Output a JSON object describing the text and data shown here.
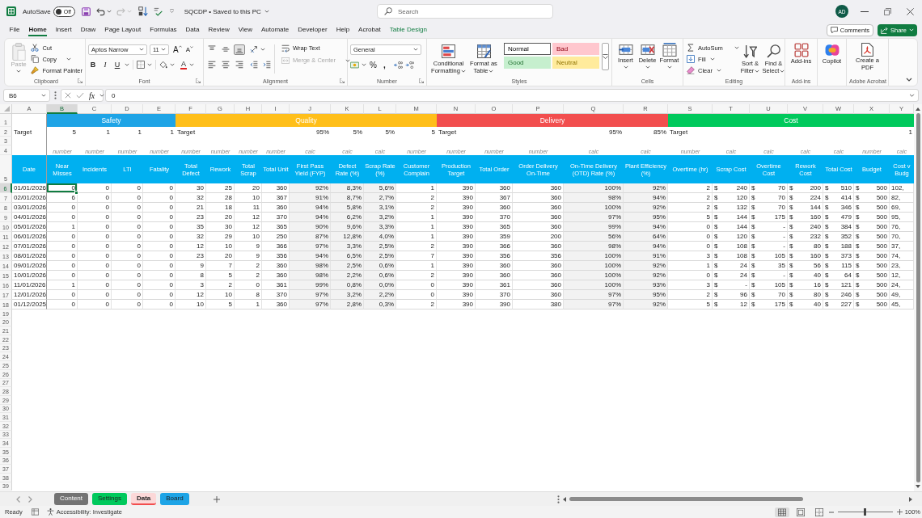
{
  "title_bar": {
    "autosave": {
      "label": "AutoSave",
      "toggle_label": "Off",
      "on": false
    },
    "undo": {
      "disabled": false
    },
    "redo": {
      "disabled": true
    },
    "document_title": "SQCDP • Saved to this PC",
    "search": {
      "placeholder": "Search"
    },
    "account_initials": "AD"
  },
  "ribbon_tabs": [
    {
      "label": "File",
      "selected": false,
      "kind": "standard"
    },
    {
      "label": "Home",
      "selected": true,
      "kind": "standard"
    },
    {
      "label": "Insert",
      "selected": false,
      "kind": "standard"
    },
    {
      "label": "Draw",
      "selected": false,
      "kind": "standard"
    },
    {
      "label": "Page Layout",
      "selected": false,
      "kind": "standard"
    },
    {
      "label": "Formulas",
      "selected": false,
      "kind": "standard"
    },
    {
      "label": "Data",
      "selected": false,
      "kind": "standard"
    },
    {
      "label": "Review",
      "selected": false,
      "kind": "standard"
    },
    {
      "label": "View",
      "selected": false,
      "kind": "standard"
    },
    {
      "label": "Automate",
      "selected": false,
      "kind": "standard"
    },
    {
      "label": "Developer",
      "selected": false,
      "kind": "standard"
    },
    {
      "label": "Help",
      "selected": false,
      "kind": "standard"
    },
    {
      "label": "Acrobat",
      "selected": false,
      "kind": "standard"
    },
    {
      "label": "Table Design",
      "selected": false,
      "kind": "contextual"
    }
  ],
  "comments_button": "Comments",
  "share_button": "Share",
  "ribbon": {
    "clipboard": {
      "label": "Clipboard",
      "paste": {
        "label": "Paste",
        "disabled": true
      },
      "actions": [
        {
          "label": "Cut",
          "disabled": false
        },
        {
          "label": "Copy",
          "disabled": false
        },
        {
          "label": "Format Painter",
          "disabled": false
        }
      ]
    },
    "font": {
      "label": "Font",
      "font_name": "Aptos Narrow",
      "font_size": "11",
      "grow_button": "A",
      "shrink_button": "A",
      "style_buttons": [
        "B",
        "I",
        "U"
      ],
      "color_button": "A"
    },
    "alignment": {
      "label": "Alignment",
      "vertical_buttons": [
        {
          "selected": false
        },
        {
          "selected": false
        },
        {
          "selected": true
        }
      ],
      "horizontal_buttons": [
        {
          "selected": false
        },
        {
          "selected": false
        },
        {
          "selected": false
        }
      ],
      "wrap_text": {
        "label": "Wrap Text",
        "disabled": false
      },
      "merge": {
        "label": "Merge & Center",
        "disabled": true
      }
    },
    "number": {
      "label": "Number",
      "format": "General",
      "percent_button": "%",
      "comma_button": ","
    },
    "styles": {
      "label": "Styles",
      "commands": [
        "Conditional Formatting",
        "Format as Table"
      ],
      "gallery": [
        {
          "label": "Normal",
          "color": "#ffffff",
          "selected": true
        },
        {
          "label": "Bad",
          "color": "#ffc7ce",
          "selected": false
        },
        {
          "label": "Good",
          "color": "#c6efce",
          "selected": false
        },
        {
          "label": "Neutral",
          "color": "#ffeb9c",
          "selected": false
        }
      ]
    },
    "cells": {
      "label": "Cells",
      "commands": [
        "Insert",
        "Delete",
        "Format"
      ]
    },
    "editing": {
      "label": "Editing",
      "small_commands": [
        "AutoSum",
        "Fill",
        "Clear"
      ],
      "large_commands": [
        "Sort & Filter",
        "Find & Select"
      ]
    },
    "add_ins": {
      "label": "Add-ins",
      "command": "Add-ins"
    },
    "copilot": {
      "command": "Copilot"
    },
    "adobe_acrobat": {
      "label": "Adobe Acrobat",
      "command": "Create a PDF"
    }
  },
  "formula_bar": {
    "name_box": "B6",
    "function_label": "fx",
    "formula": "0"
  },
  "sheet": {
    "lead_column": {
      "letter": "A",
      "selected": false,
      "kind": "text",
      "shaded": false,
      "target_label": "Target",
      "header": "Date",
      "cells": [
        "01/01/2026",
        "02/01/2026",
        "03/01/2026",
        "04/01/2026",
        "05/01/2026",
        "06/01/2026",
        "07/01/2026",
        "08/01/2026",
        "09/01/2026",
        "10/01/2026",
        "11/01/2026",
        "12/01/2026",
        "01/12/2025"
      ]
    },
    "sections": [
      {
        "label": "Safety",
        "color": "#1ea4e6",
        "columns": [
          {
            "letter": "B",
            "selected": true,
            "kind": "number",
            "shaded": false,
            "target": "5",
            "entry_type": "number",
            "header": "Near Misses",
            "cells": [
              "0",
              "6",
              "0",
              "0",
              "1",
              "0",
              "0",
              "0",
              "0",
              "0",
              "1",
              "0",
              "0"
            ]
          },
          {
            "letter": "C",
            "selected": false,
            "kind": "number",
            "shaded": false,
            "target": "1",
            "entry_type": "number",
            "header": "Incidents",
            "cells": [
              "0",
              "0",
              "0",
              "0",
              "0",
              "0",
              "0",
              "0",
              "0",
              "0",
              "0",
              "0",
              "0"
            ]
          },
          {
            "letter": "D",
            "selected": false,
            "kind": "number",
            "shaded": false,
            "target": "1",
            "entry_type": "number",
            "header": "LTI",
            "cells": [
              "0",
              "0",
              "0",
              "0",
              "0",
              "0",
              "0",
              "0",
              "0",
              "0",
              "0",
              "0",
              "0"
            ]
          },
          {
            "letter": "E",
            "selected": false,
            "kind": "number",
            "shaded": false,
            "target": "1",
            "entry_type": "number",
            "header": "Fatality",
            "cells": [
              "0",
              "0",
              "0",
              "0",
              "0",
              "0",
              "0",
              "0",
              "0",
              "0",
              "0",
              "0",
              "0"
            ]
          }
        ]
      },
      {
        "label": "Quality",
        "color": "#ffbf1a",
        "columns": [
          {
            "letter": "F",
            "selected": false,
            "kind": "number",
            "shaded": false,
            "target_label": "Target",
            "entry_type": "number",
            "header": "Total Defect",
            "cells": [
              "30",
              "32",
              "21",
              "23",
              "35",
              "32",
              "12",
              "23",
              "9",
              "8",
              "3",
              "12",
              "10"
            ]
          },
          {
            "letter": "G",
            "selected": false,
            "kind": "number",
            "shaded": false,
            "entry_type": "number",
            "header": "Rework",
            "cells": [
              "25",
              "28",
              "18",
              "20",
              "30",
              "29",
              "10",
              "20",
              "7",
              "5",
              "2",
              "10",
              "5"
            ]
          },
          {
            "letter": "H",
            "selected": false,
            "kind": "number",
            "shaded": false,
            "entry_type": "number",
            "header": "Total Scrap",
            "cells": [
              "20",
              "10",
              "11",
              "12",
              "12",
              "10",
              "9",
              "9",
              "2",
              "2",
              "0",
              "8",
              "1"
            ]
          },
          {
            "letter": "I",
            "selected": false,
            "kind": "number",
            "shaded": false,
            "entry_type": "number",
            "header": "Total Unit",
            "cells": [
              "360",
              "367",
              "360",
              "370",
              "365",
              "250",
              "366",
              "356",
              "360",
              "360",
              "361",
              "370",
              "360"
            ]
          },
          {
            "letter": "J",
            "selected": false,
            "kind": "number",
            "shaded": true,
            "target": "95%",
            "entry_type": "calc",
            "header": "First Pass Yield (FYP)",
            "cells": [
              "92%",
              "91%",
              "94%",
              "94%",
              "90%",
              "87%",
              "97%",
              "94%",
              "98%",
              "98%",
              "99%",
              "97%",
              "97%"
            ]
          },
          {
            "letter": "K",
            "selected": false,
            "kind": "number",
            "shaded": true,
            "target": "5%",
            "entry_type": "calc",
            "header": "Defect Rate (%)",
            "cells": [
              "8,3%",
              "8,7%",
              "5,8%",
              "6,2%",
              "9,6%",
              "12,8%",
              "3,3%",
              "6,5%",
              "2,5%",
              "2,2%",
              "0,8%",
              "3,2%",
              "2,8%"
            ]
          },
          {
            "letter": "L",
            "selected": false,
            "kind": "number",
            "shaded": true,
            "target": "5%",
            "entry_type": "calc",
            "header": "Scrap Rate (%)",
            "cells": [
              "5,6%",
              "2,7%",
              "3,1%",
              "3,2%",
              "3,3%",
              "4,0%",
              "2,5%",
              "2,5%",
              "0,6%",
              "0,6%",
              "0,0%",
              "2,2%",
              "0,3%"
            ]
          },
          {
            "letter": "M",
            "selected": false,
            "kind": "number",
            "shaded": false,
            "target": "5",
            "entry_type": "number",
            "header": "Customer Complain",
            "cells": [
              "1",
              "2",
              "2",
              "1",
              "1",
              "1",
              "2",
              "7",
              "1",
              "2",
              "0",
              "0",
              "2"
            ]
          }
        ]
      },
      {
        "label": "Delivery",
        "color": "#f24e4e",
        "columns": [
          {
            "letter": "N",
            "selected": false,
            "kind": "number",
            "shaded": false,
            "target_label": "Target",
            "entry_type": "number",
            "header": "Production Target",
            "cells": [
              "390",
              "390",
              "390",
              "390",
              "390",
              "390",
              "390",
              "390",
              "390",
              "390",
              "390",
              "390",
              "390"
            ]
          },
          {
            "letter": "O",
            "selected": false,
            "kind": "number",
            "shaded": false,
            "entry_type": "number",
            "header": "Total Order",
            "cells": [
              "360",
              "367",
              "360",
              "370",
              "365",
              "359",
              "366",
              "356",
              "360",
              "360",
              "361",
              "370",
              "390"
            ]
          },
          {
            "letter": "P",
            "selected": false,
            "kind": "number",
            "shaded": false,
            "entry_type": "number",
            "header": "Order Delivery On-Time",
            "cells": [
              "360",
              "360",
              "360",
              "360",
              "360",
              "200",
              "360",
              "356",
              "360",
              "360",
              "360",
              "360",
              "380"
            ]
          },
          {
            "letter": "Q",
            "selected": false,
            "kind": "number",
            "shaded": true,
            "target": "95%",
            "entry_type": "calc",
            "header": "On-Time Delivery (OTD) Rate (%)",
            "cells": [
              "100%",
              "98%",
              "100%",
              "97%",
              "99%",
              "56%",
              "98%",
              "100%",
              "100%",
              "100%",
              "100%",
              "97%",
              "97%"
            ]
          },
          {
            "letter": "R",
            "selected": false,
            "kind": "number",
            "shaded": true,
            "target": "85%",
            "entry_type": "calc",
            "header": "Plant Efficiency (%)",
            "cells": [
              "92%",
              "94%",
              "92%",
              "95%",
              "94%",
              "64%",
              "94%",
              "91%",
              "92%",
              "92%",
              "93%",
              "95%",
              "92%"
            ]
          }
        ]
      },
      {
        "label": "Cost",
        "color": "#00c95c",
        "columns": [
          {
            "letter": "S",
            "selected": false,
            "kind": "number",
            "shaded": false,
            "target_label": "Target",
            "entry_type": "number",
            "header": "Overtime (hr)",
            "cells": [
              "2",
              "2",
              "2",
              "5",
              "0",
              "0",
              "0",
              "3",
              "1",
              "0",
              "3",
              "2",
              "5"
            ]
          },
          {
            "letter": "T",
            "selected": false,
            "kind": "currency",
            "shaded": false,
            "entry_type": "calc",
            "header": "Scrap Cost",
            "cells": [
              {
                "symbol": "$",
                "amount": "240"
              },
              {
                "symbol": "$",
                "amount": "120"
              },
              {
                "symbol": "$",
                "amount": "132"
              },
              {
                "symbol": "$",
                "amount": "144"
              },
              {
                "symbol": "$",
                "amount": "144"
              },
              {
                "symbol": "$",
                "amount": "120"
              },
              {
                "symbol": "$",
                "amount": "108"
              },
              {
                "symbol": "$",
                "amount": "108"
              },
              {
                "symbol": "$",
                "amount": "24"
              },
              {
                "symbol": "$",
                "amount": "24"
              },
              {
                "symbol": "$",
                "amount": "-"
              },
              {
                "symbol": "$",
                "amount": "96"
              },
              {
                "symbol": "$",
                "amount": "12"
              }
            ]
          },
          {
            "letter": "U",
            "selected": false,
            "kind": "currency",
            "shaded": false,
            "entry_type": "calc",
            "header": "Overtime Cost",
            "cells": [
              {
                "symbol": "$",
                "amount": "70"
              },
              {
                "symbol": "$",
                "amount": "70"
              },
              {
                "symbol": "$",
                "amount": "70"
              },
              {
                "symbol": "$",
                "amount": "175"
              },
              {
                "symbol": "$",
                "amount": "-"
              },
              {
                "symbol": "$",
                "amount": "-"
              },
              {
                "symbol": "$",
                "amount": "-"
              },
              {
                "symbol": "$",
                "amount": "105"
              },
              {
                "symbol": "$",
                "amount": "35"
              },
              {
                "symbol": "$",
                "amount": "-"
              },
              {
                "symbol": "$",
                "amount": "105"
              },
              {
                "symbol": "$",
                "amount": "70"
              },
              {
                "symbol": "$",
                "amount": "175"
              }
            ]
          },
          {
            "letter": "V",
            "selected": false,
            "kind": "currency",
            "shaded": false,
            "entry_type": "calc",
            "header": "Rework Cost",
            "cells": [
              {
                "symbol": "$",
                "amount": "200"
              },
              {
                "symbol": "$",
                "amount": "224"
              },
              {
                "symbol": "$",
                "amount": "144"
              },
              {
                "symbol": "$",
                "amount": "160"
              },
              {
                "symbol": "$",
                "amount": "240"
              },
              {
                "symbol": "$",
                "amount": "232"
              },
              {
                "symbol": "$",
                "amount": "80"
              },
              {
                "symbol": "$",
                "amount": "160"
              },
              {
                "symbol": "$",
                "amount": "56"
              },
              {
                "symbol": "$",
                "amount": "40"
              },
              {
                "symbol": "$",
                "amount": "16"
              },
              {
                "symbol": "$",
                "amount": "80"
              },
              {
                "symbol": "$",
                "amount": "40"
              }
            ]
          },
          {
            "letter": "W",
            "selected": false,
            "kind": "currency",
            "shaded": false,
            "entry_type": "calc",
            "header": "Total Cost",
            "cells": [
              {
                "symbol": "$",
                "amount": "510"
              },
              {
                "symbol": "$",
                "amount": "414"
              },
              {
                "symbol": "$",
                "amount": "346"
              },
              {
                "symbol": "$",
                "amount": "479"
              },
              {
                "symbol": "$",
                "amount": "384"
              },
              {
                "symbol": "$",
                "amount": "352"
              },
              {
                "symbol": "$",
                "amount": "188"
              },
              {
                "symbol": "$",
                "amount": "373"
              },
              {
                "symbol": "$",
                "amount": "115"
              },
              {
                "symbol": "$",
                "amount": "64"
              },
              {
                "symbol": "$",
                "amount": "121"
              },
              {
                "symbol": "$",
                "amount": "246"
              },
              {
                "symbol": "$",
                "amount": "227"
              }
            ]
          },
          {
            "letter": "X",
            "selected": false,
            "kind": "currency",
            "shaded": false,
            "entry_type": "number",
            "header": "Budget",
            "cells": [
              {
                "symbol": "$",
                "amount": "500"
              },
              {
                "symbol": "$",
                "amount": "500"
              },
              {
                "symbol": "$",
                "amount": "500"
              },
              {
                "symbol": "$",
                "amount": "500"
              },
              {
                "symbol": "$",
                "amount": "500"
              },
              {
                "symbol": "$",
                "amount": "500"
              },
              {
                "symbol": "$",
                "amount": "500"
              },
              {
                "symbol": "$",
                "amount": "500"
              },
              {
                "symbol": "$",
                "amount": "500"
              },
              {
                "symbol": "$",
                "amount": "500"
              },
              {
                "symbol": "$",
                "amount": "500"
              },
              {
                "symbol": "$",
                "amount": "500"
              },
              {
                "symbol": "$",
                "amount": "500"
              }
            ]
          },
          {
            "letter": "Y",
            "selected": false,
            "kind": "partial",
            "shaded": false,
            "target": "1",
            "entry_type": "calc",
            "header": "Cost v Budg",
            "cells": [
              "102,",
              "82,",
              "69,",
              "95,",
              "76,",
              "70,",
              "37,",
              "74,",
              "23,",
              "12,",
              "24,",
              "49,",
              "45,"
            ]
          }
        ]
      }
    ],
    "row_headers": [
      {
        "number": "1",
        "selected": false
      },
      {
        "number": "2",
        "selected": false
      },
      {
        "number": "3",
        "selected": false
      },
      {
        "number": "4",
        "selected": false
      },
      {
        "number": "5",
        "selected": false
      },
      {
        "number": "6",
        "selected": true
      },
      {
        "number": "7",
        "selected": false
      },
      {
        "number": "8",
        "selected": false
      },
      {
        "number": "9",
        "selected": false
      },
      {
        "number": "10",
        "selected": false
      },
      {
        "number": "11",
        "selected": false
      },
      {
        "number": "12",
        "selected": false
      },
      {
        "number": "13",
        "selected": false
      },
      {
        "number": "14",
        "selected": false
      },
      {
        "number": "15",
        "selected": false
      },
      {
        "number": "16",
        "selected": false
      },
      {
        "number": "17",
        "selected": false
      },
      {
        "number": "18",
        "selected": false
      },
      {
        "number": "19",
        "selected": false
      },
      {
        "number": "20",
        "selected": false
      },
      {
        "number": "21",
        "selected": false
      },
      {
        "number": "22",
        "selected": false
      },
      {
        "number": "23",
        "selected": false
      },
      {
        "number": "24",
        "selected": false
      },
      {
        "number": "25",
        "selected": false
      },
      {
        "number": "26",
        "selected": false
      },
      {
        "number": "27",
        "selected": false
      },
      {
        "number": "28",
        "selected": false
      },
      {
        "number": "29",
        "selected": false
      },
      {
        "number": "30",
        "selected": false
      },
      {
        "number": "31",
        "selected": false
      },
      {
        "number": "32",
        "selected": false
      },
      {
        "number": "33",
        "selected": false
      },
      {
        "number": "34",
        "selected": false
      },
      {
        "number": "35",
        "selected": false
      },
      {
        "number": "36",
        "selected": false
      },
      {
        "number": "37",
        "selected": false
      },
      {
        "number": "38",
        "selected": false
      },
      {
        "number": "39",
        "selected": false
      }
    ]
  },
  "sheet_tabs": [
    {
      "label": "Content",
      "color": "#737373",
      "selected": false
    },
    {
      "label": "Settings",
      "color": "#00c95c",
      "selected": false
    },
    {
      "label": "Data",
      "color": "#f24e4e",
      "selected": true
    },
    {
      "label": "Board",
      "color": "#1ea4e6",
      "selected": false
    }
  ],
  "status_bar": {
    "mode": "Ready",
    "accessibility": "Accessibility: Investigate",
    "views": [
      {
        "selected": true
      },
      {
        "selected": false
      },
      {
        "selected": false
      }
    ],
    "zoom_slider": {
      "level": 0.5
    },
    "zoom_label": "100%"
  }
}
